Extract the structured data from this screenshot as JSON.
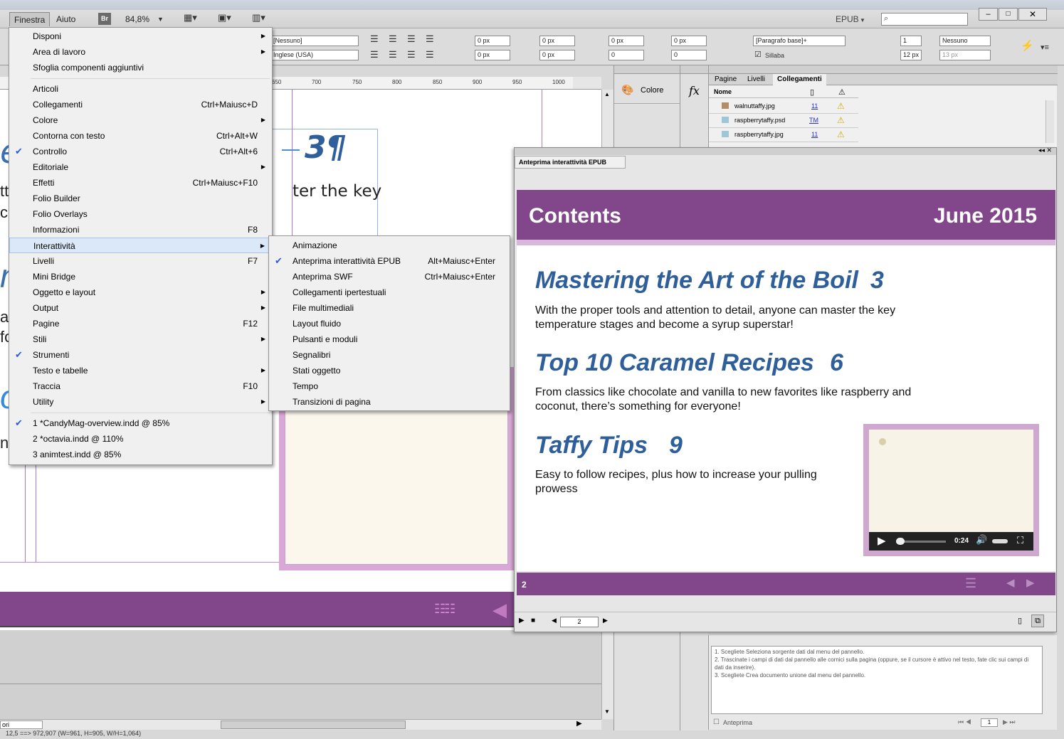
{
  "menubar": {
    "items": [
      "Finestra",
      "Aiuto"
    ],
    "bridge_label": "Br",
    "zoom": "84,8%",
    "workspace": "EPUB",
    "search_placeholder": ""
  },
  "control": {
    "char_style": "[Nessuno]",
    "language": "Inglese (USA)",
    "indent_left": "0 px",
    "indent_right": "0 px",
    "indent_first": "0 px",
    "indent_last": "0 px",
    "space_before": "0 px",
    "space_after": "0 px",
    "drop_lines": "0",
    "drop_chars": "0",
    "para_style": "[Paragrafo base]+",
    "hyphenate_label": "Sillaba",
    "columns": "1",
    "grid": "Nessuno",
    "gutter": "12 px",
    "baseline": "13 px"
  },
  "ruler_ticks": [
    "650",
    "700",
    "750",
    "800",
    "850",
    "900",
    "950",
    "1000"
  ],
  "document": {
    "entry_number": "3¶",
    "body_fragment": "ter the key",
    "left_fragments": [
      "e",
      "tt",
      "co",
      "n",
      "a",
      "fo",
      "o",
      "n"
    ]
  },
  "finestra_menu": {
    "items": [
      {
        "label": "Disponi",
        "shortcut": "",
        "submenu": true,
        "checked": false
      },
      {
        "label": "Area di lavoro",
        "shortcut": "",
        "submenu": true,
        "checked": false
      },
      {
        "label": "Sfoglia componenti aggiuntivi",
        "shortcut": "",
        "submenu": false,
        "checked": false
      },
      {
        "label": "Articoli",
        "shortcut": "",
        "submenu": false,
        "checked": false
      },
      {
        "label": "Collegamenti",
        "shortcut": "Ctrl+Maiusc+D",
        "submenu": false,
        "checked": false
      },
      {
        "label": "Colore",
        "shortcut": "",
        "submenu": true,
        "checked": false
      },
      {
        "label": "Contorna con testo",
        "shortcut": "Ctrl+Alt+W",
        "submenu": false,
        "checked": false
      },
      {
        "label": "Controllo",
        "shortcut": "Ctrl+Alt+6",
        "submenu": false,
        "checked": true
      },
      {
        "label": "Editoriale",
        "shortcut": "",
        "submenu": true,
        "checked": false
      },
      {
        "label": "Effetti",
        "shortcut": "Ctrl+Maiusc+F10",
        "submenu": false,
        "checked": false
      },
      {
        "label": "Folio Builder",
        "shortcut": "",
        "submenu": false,
        "checked": false
      },
      {
        "label": "Folio Overlays",
        "shortcut": "",
        "submenu": false,
        "checked": false
      },
      {
        "label": "Informazioni",
        "shortcut": "F8",
        "submenu": false,
        "checked": false
      },
      {
        "label": "Interattività",
        "shortcut": "",
        "submenu": true,
        "checked": false,
        "highlighted": true
      },
      {
        "label": "Livelli",
        "shortcut": "F7",
        "submenu": false,
        "checked": false
      },
      {
        "label": "Mini Bridge",
        "shortcut": "",
        "submenu": false,
        "checked": false
      },
      {
        "label": "Oggetto e layout",
        "shortcut": "",
        "submenu": true,
        "checked": false
      },
      {
        "label": "Output",
        "shortcut": "",
        "submenu": true,
        "checked": false
      },
      {
        "label": "Pagine",
        "shortcut": "F12",
        "submenu": false,
        "checked": false
      },
      {
        "label": "Stili",
        "shortcut": "",
        "submenu": true,
        "checked": false
      },
      {
        "label": "Strumenti",
        "shortcut": "",
        "submenu": false,
        "checked": true
      },
      {
        "label": "Testo e tabelle",
        "shortcut": "",
        "submenu": true,
        "checked": false
      },
      {
        "label": "Traccia",
        "shortcut": "F10",
        "submenu": false,
        "checked": false
      },
      {
        "label": "Utility",
        "shortcut": "",
        "submenu": true,
        "checked": false
      },
      {
        "label": "1 *CandyMag-overview.indd @ 85%",
        "shortcut": "",
        "submenu": false,
        "checked": true
      },
      {
        "label": "2 *octavia.indd @ 110%",
        "shortcut": "",
        "submenu": false,
        "checked": false
      },
      {
        "label": "3 animtest.indd @ 85%",
        "shortcut": "",
        "submenu": false,
        "checked": false
      }
    ]
  },
  "interattivita_menu": {
    "items": [
      {
        "label": "Animazione",
        "shortcut": "",
        "checked": false
      },
      {
        "label": "Anteprima interattività EPUB",
        "shortcut": "Alt+Maiusc+Enter",
        "checked": true
      },
      {
        "label": "Anteprima SWF",
        "shortcut": "Ctrl+Maiusc+Enter",
        "checked": false
      },
      {
        "label": "Collegamenti ipertestuali",
        "shortcut": "",
        "checked": false
      },
      {
        "label": "File multimediali",
        "shortcut": "",
        "checked": false
      },
      {
        "label": "Layout fluido",
        "shortcut": "",
        "checked": false
      },
      {
        "label": "Pulsanti e moduli",
        "shortcut": "",
        "checked": false
      },
      {
        "label": "Segnalibri",
        "shortcut": "",
        "checked": false
      },
      {
        "label": "Stati oggetto",
        "shortcut": "",
        "checked": false
      },
      {
        "label": "Tempo",
        "shortcut": "",
        "checked": false
      },
      {
        "label": "Transizioni di pagina",
        "shortcut": "",
        "checked": false
      }
    ]
  },
  "panels": {
    "colore_label": "Colore",
    "fx_label": "fx",
    "tabs": [
      "Pagine",
      "Livelli",
      "Collegamenti"
    ],
    "links_header": "Nome",
    "links": [
      {
        "name": "walnuttaffy.jpg",
        "page": "11"
      },
      {
        "name": "raspberrytaffy.psd",
        "page": "TM"
      },
      {
        "name": "raspberrytaffy.jpg",
        "page": "11"
      }
    ],
    "data_merge_text": "1. Scegliete Seleziona sorgente dati dal menu del pannello.\n2. Trascinate i campi di dati dal pannello alle cornici sulla pagina (oppure, se il cursore è attivo nel testo, fate clic sui campi di dati da inserire).\n3. Scegliete Crea documento unione dal menu del pannello.",
    "anteprima_label": "Anteprima",
    "record_number": "1"
  },
  "epub": {
    "panel_title": "Anteprima interattività EPUB",
    "header_title": "Contents",
    "header_date": "June 2015",
    "articles": [
      {
        "title": "Mastering the Art of the Boil",
        "page": "3",
        "desc": "With the proper tools and attention to detail, anyone can master the key temperature stages and become a syrup superstar!"
      },
      {
        "title": "Top 10 Caramel Recipes",
        "page": "6",
        "desc": "From classics like chocolate and vanilla to new favorites like raspberry and coconut, there’s something for everyone!"
      },
      {
        "title": "Taffy Tips",
        "page": "9",
        "desc": "Easy to follow recipes, plus how to increase your pulling prowess"
      }
    ],
    "video_time": "0:24",
    "footer_page": "2",
    "page_field": "2"
  },
  "status": {
    "coords": "12,5 ==> 972,907 (W=961, H=905, W/H=1,064)",
    "view_field": "ori"
  },
  "colors": {
    "accent_purple": "#81478a",
    "title_blue": "#2e5f9b",
    "menu_check": "#2a5dd6"
  }
}
